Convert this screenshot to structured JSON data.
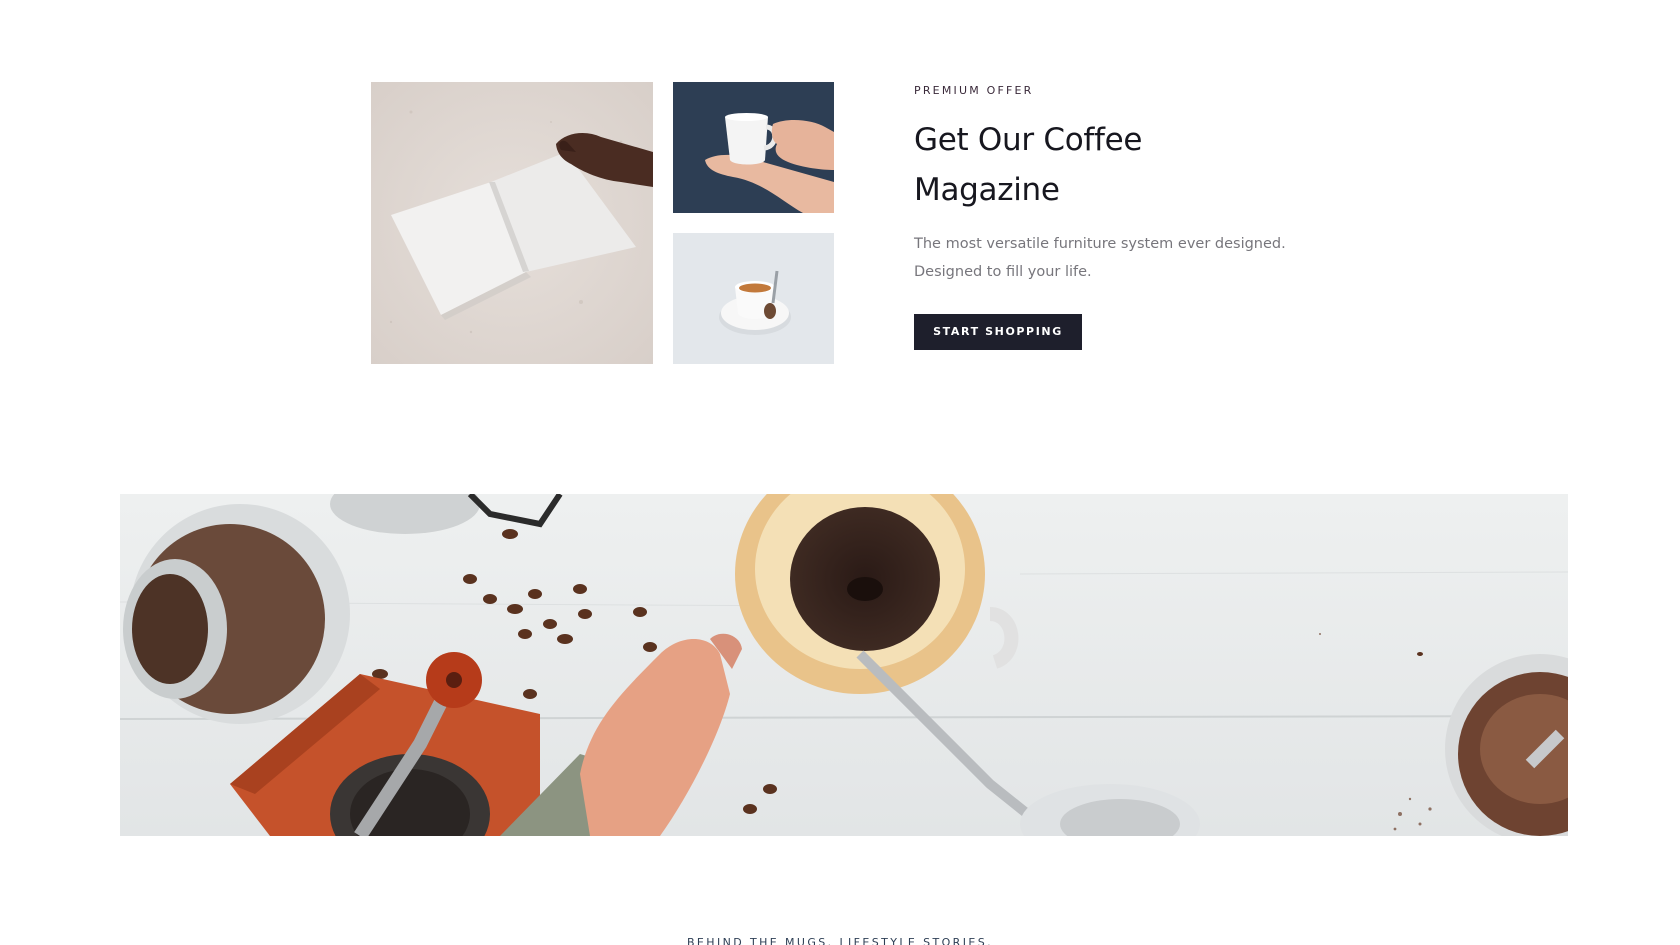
{
  "promo": {
    "eyebrow": "PREMIUM OFFER",
    "headline_line1": "Get Our Coffee",
    "headline_line2": "Magazine",
    "desc_line1": "The most versatile furniture system ever designed.",
    "desc_line2": "Designed to fill your life.",
    "cta_label": "START SHOPPING"
  },
  "tagline": "BEHIND THE MUGS. LIFESTYLE STORIES.",
  "colors": {
    "button_bg": "#1e1f2c",
    "heading": "#17171f",
    "body_text": "#77767c",
    "tagline": "#2e3f55"
  }
}
